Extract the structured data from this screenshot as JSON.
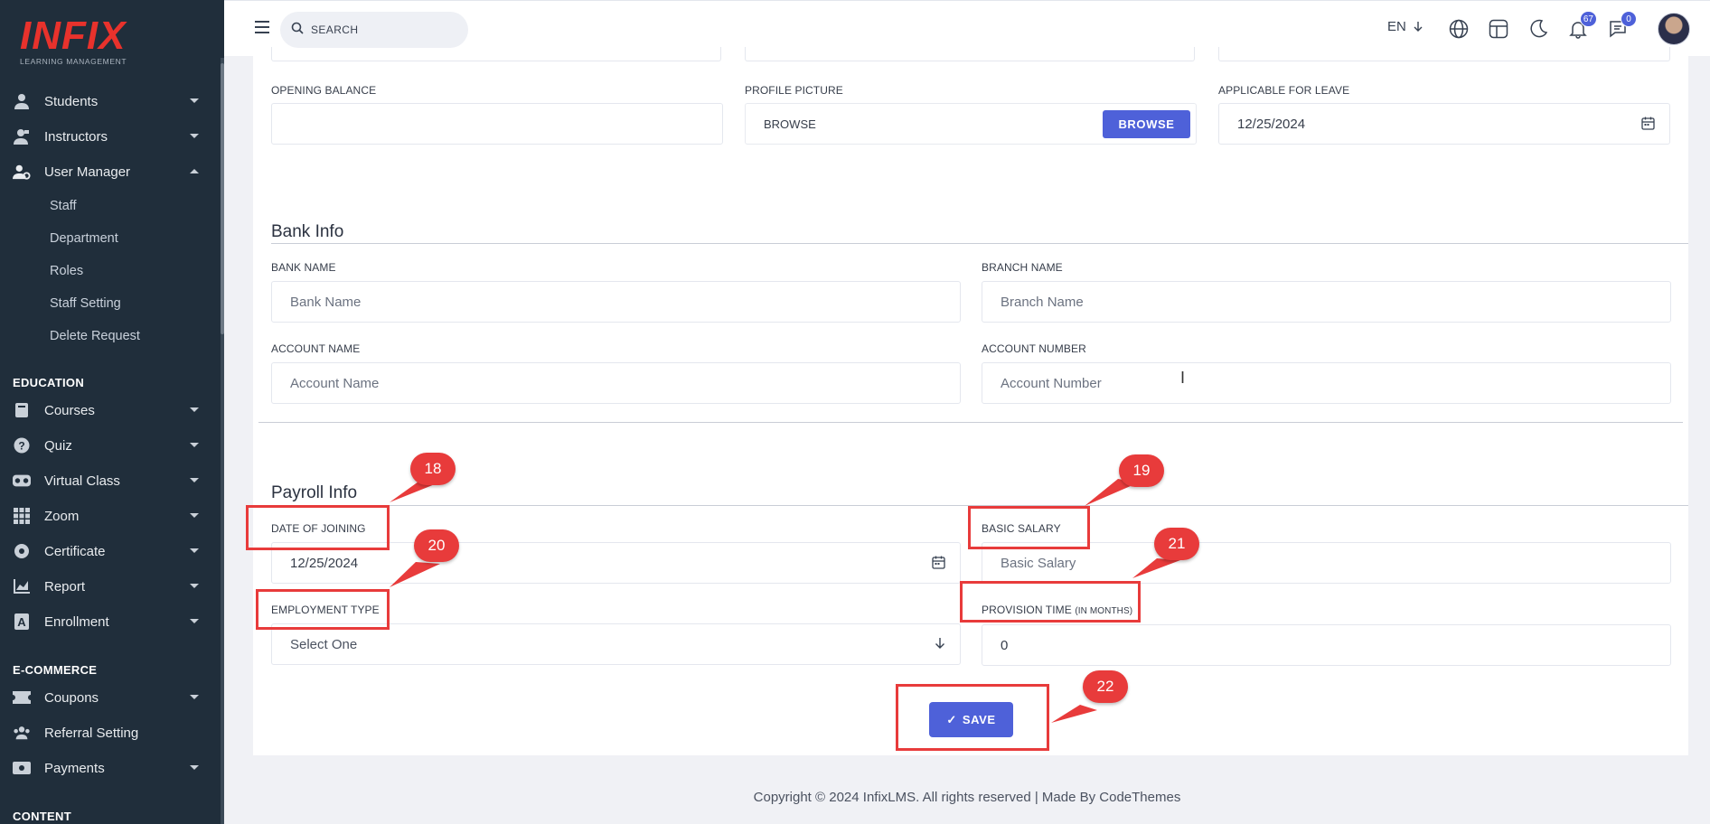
{
  "brand": {
    "logo": "INFIX",
    "tagline": "LEARNING MANAGEMENT",
    "accent": "#4e61d9",
    "logo_color": "#e8322c"
  },
  "sidebar": {
    "items": [
      {
        "label": "Students",
        "icon": "user-icon"
      },
      {
        "label": "Instructors",
        "icon": "instructor-icon"
      },
      {
        "label": "User Manager",
        "icon": "user-gear-icon",
        "expanded": true
      }
    ],
    "user_manager_sub": [
      "Staff",
      "Department",
      "Roles",
      "Staff Setting",
      "Delete Request"
    ],
    "education_heading": "EDUCATION",
    "education_items": [
      {
        "label": "Courses",
        "icon": "book-icon"
      },
      {
        "label": "Quiz",
        "icon": "question-circle-icon"
      },
      {
        "label": "Virtual Class",
        "icon": "vr-headset-icon"
      },
      {
        "label": "Zoom",
        "icon": "grid-icon"
      },
      {
        "label": "Certificate",
        "icon": "certificate-icon"
      },
      {
        "label": "Report",
        "icon": "chart-icon"
      },
      {
        "label": "Enrollment",
        "icon": "enrollment-icon"
      }
    ],
    "ecommerce_heading": "E-COMMERCE",
    "ecommerce_items": [
      {
        "label": "Coupons",
        "icon": "ticket-icon"
      },
      {
        "label": "Referral Setting",
        "icon": "users-icon"
      },
      {
        "label": "Payments",
        "icon": "money-icon"
      }
    ],
    "content_heading": "CONTENT"
  },
  "topbar": {
    "search_placeholder": "SEARCH",
    "language": "EN",
    "notifications_count": "67",
    "messages_count": "0"
  },
  "form": {
    "opening_balance": {
      "label": "OPENING BALANCE",
      "value": ""
    },
    "profile_picture": {
      "label": "PROFILE PICTURE",
      "value": "BROWSE",
      "button": "BROWSE"
    },
    "applicable_for_leave": {
      "label": "APPLICABLE FOR LEAVE",
      "value": "12/25/2024"
    },
    "bank_info": {
      "title": "Bank Info",
      "bank_name": {
        "label": "BANK NAME",
        "placeholder": "Bank Name"
      },
      "branch_name": {
        "label": "BRANCH NAME",
        "placeholder": "Branch Name"
      },
      "account_name": {
        "label": "ACCOUNT NAME",
        "placeholder": "Account Name"
      },
      "account_number": {
        "label": "ACCOUNT NUMBER",
        "placeholder": "Account Number"
      }
    },
    "payroll_info": {
      "title": "Payroll Info",
      "date_of_joining": {
        "label": "DATE OF JOINING",
        "value": "12/25/2024"
      },
      "basic_salary": {
        "label": "BASIC SALARY",
        "placeholder": "Basic Salary"
      },
      "employment_type": {
        "label": "EMPLOYMENT TYPE",
        "value": "Select One"
      },
      "provision_time": {
        "label": "PROVISION TIME",
        "label_suffix": "(IN MONTHS)",
        "value": "0"
      }
    },
    "save_label": "SAVE"
  },
  "annotations": [
    "18",
    "19",
    "20",
    "21",
    "22"
  ],
  "footer": "Copyright © 2024 InfixLMS. All rights reserved | Made By CodeThemes"
}
